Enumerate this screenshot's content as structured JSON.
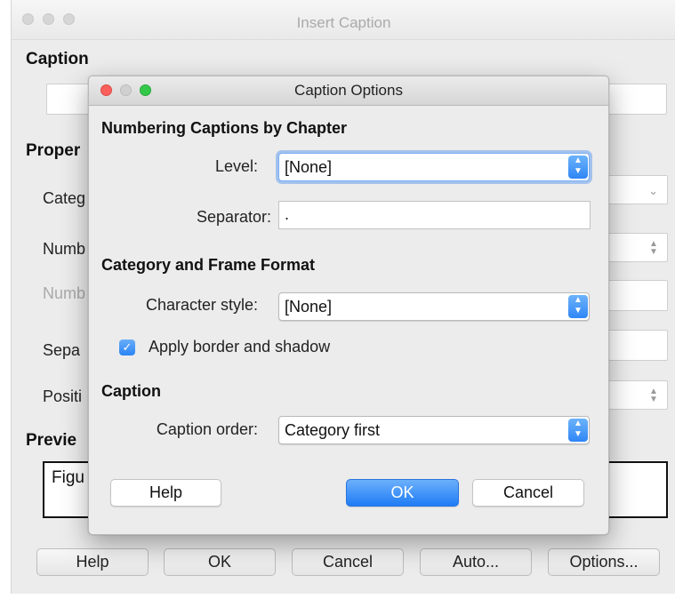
{
  "outer": {
    "title": "Insert Caption",
    "caption_heading": "Caption",
    "caption_value": "",
    "properties_heading": "Proper",
    "labels": {
      "category": "Categ",
      "numbering": "Numb",
      "numbering_separator": "Numb",
      "separator": "Sepa",
      "position": "Positi"
    },
    "preview_heading": "Previe",
    "preview_text": "Figu",
    "buttons": {
      "help": "Help",
      "ok": "OK",
      "cancel": "Cancel",
      "auto": "Auto...",
      "options": "Options..."
    }
  },
  "dialog": {
    "title": "Caption Options",
    "section_numbering": "Numbering Captions by Chapter",
    "level_label": "Level:",
    "level_value": "[None]",
    "separator_label": "Separator:",
    "separator_value": ".",
    "section_category": "Category and Frame Format",
    "char_style_label": "Character style:",
    "char_style_value": "[None]",
    "apply_border_label": "Apply border and shadow",
    "apply_border_checked": true,
    "section_caption": "Caption",
    "caption_order_label": "Caption order:",
    "caption_order_value": "Category first",
    "buttons": {
      "help": "Help",
      "ok": "OK",
      "cancel": "Cancel"
    }
  },
  "colors": {
    "accent": "#2f86f6",
    "traffic_close": "#fc605c",
    "traffic_minimize": "#d0d0d0",
    "traffic_zoom": "#34c84a"
  },
  "icons": {
    "checkbox": "checkmark-icon",
    "stepper": "up-down-chevron-icon",
    "combo": "chevron-down-icon"
  }
}
